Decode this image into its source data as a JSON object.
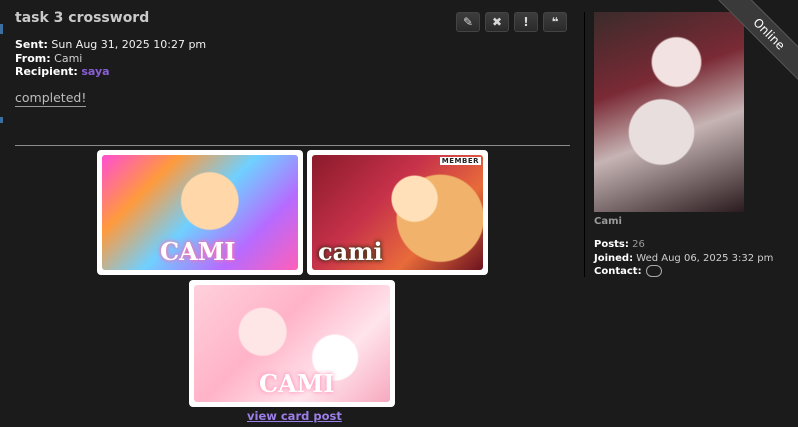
{
  "message": {
    "title": "task 3 crossword",
    "sent_label": "Sent:",
    "sent_value": "Sun Aug 31, 2025 10:27 pm",
    "from_label": "From:",
    "from_value": "Cami",
    "recipient_label": "Recipient:",
    "recipient_value": "saya",
    "body": "completed!"
  },
  "toolbar": {
    "edit_icon": "✎",
    "delete_icon": "✖",
    "report_icon": "!",
    "quote_icon": "❝"
  },
  "cards": [
    {
      "name": "CAMI",
      "art": "art1"
    },
    {
      "name": "cami",
      "art": "art2",
      "tag": "MEMBER"
    },
    {
      "name": "CAMI",
      "art": "art3"
    }
  ],
  "view_link": "view card post",
  "profile": {
    "status": "Online",
    "username": "Cami",
    "posts_label": "Posts:",
    "posts_value": "26",
    "joined_label": "Joined:",
    "joined_value": "Wed Aug 06, 2025 3:32 pm",
    "contact_label": "Contact:"
  }
}
